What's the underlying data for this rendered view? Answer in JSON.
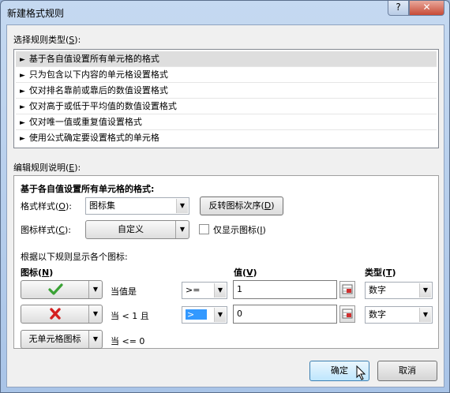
{
  "dialog": {
    "title": "新建格式规则",
    "help_symbol": "?",
    "close_symbol": "✕"
  },
  "rule_type": {
    "label_prefix": "选择规则类型(",
    "label_key": "S",
    "label_suffix": "):",
    "items": [
      "基于各自值设置所有单元格的格式",
      "只为包含以下内容的单元格设置格式",
      "仅对排名靠前或靠后的数值设置格式",
      "仅对高于或低于平均值的数值设置格式",
      "仅对唯一值或重复值设置格式",
      "使用公式确定要设置格式的单元格"
    ],
    "selected_index": 0
  },
  "edit": {
    "label_prefix": "编辑规则说明(",
    "label_key": "E",
    "label_suffix": "):",
    "heading": "基于各自值设置所有单元格的格式:",
    "format_style": {
      "label_prefix": "格式样式(",
      "label_key": "O",
      "label_suffix": "):",
      "value": "图标集"
    },
    "reverse_button": {
      "prefix": "反转图标次序(",
      "key": "D",
      "suffix": ")"
    },
    "icon_style": {
      "label_prefix": "图标样式(",
      "label_key": "C",
      "label_suffix": "):",
      "value": "自定义"
    },
    "show_icon_only": {
      "prefix": "仅显示图标(",
      "key": "I",
      "suffix": ")",
      "checked": false
    },
    "rules_caption": "根据以下规则显示各个图标:",
    "col_icon": {
      "prefix": "图标(",
      "key": "N",
      "suffix": ")"
    },
    "col_value": {
      "prefix": "值(",
      "key": "V",
      "suffix": ")"
    },
    "col_type": {
      "prefix": "类型(",
      "key": "T",
      "suffix": ")"
    },
    "rows": [
      {
        "icon": "check-icon",
        "condition_prefix": "当值是",
        "operator": ">=",
        "value": "1",
        "type": "数字"
      },
      {
        "icon": "cross-icon",
        "condition_prefix": "当 < 1 且",
        "operator": ">",
        "value": "0",
        "type": "数字"
      }
    ],
    "last_row": {
      "icon_label": "无单元格图标",
      "condition": "当 <= 0"
    }
  },
  "buttons": {
    "ok": "确定",
    "cancel": "取消"
  },
  "colors": {
    "check": "#3aa235",
    "cross": "#d42020",
    "selection": "#3399ff"
  }
}
